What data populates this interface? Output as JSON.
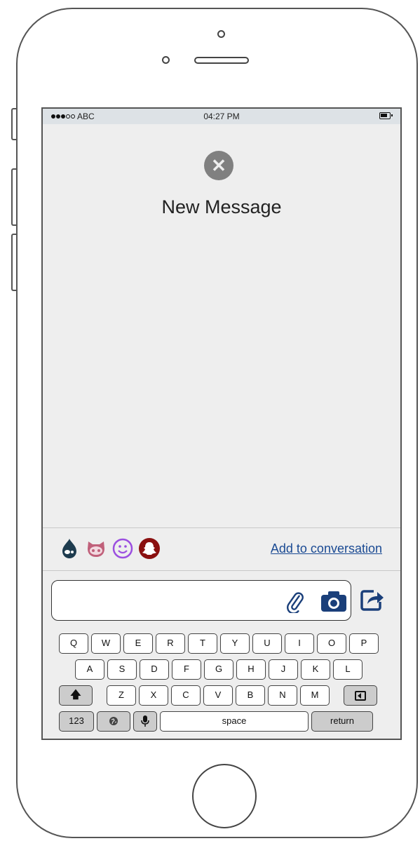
{
  "status_bar": {
    "carrier": "ABC",
    "time": "04:27 PM"
  },
  "screen": {
    "title": "New Message",
    "close_icon": "close-circle-icon"
  },
  "apps": {
    "icons": [
      "drupal-icon",
      "github-octocat-icon",
      "smiley-face-icon",
      "snapchat-ghost-icon"
    ],
    "colors": [
      "#1d3b4e",
      "#c0607a",
      "#9b4fe0",
      "#8a1010"
    ],
    "add_link": "Add to conversation"
  },
  "composer": {
    "placeholder": "",
    "attach_icon": "paperclip-icon",
    "camera_icon": "camera-icon",
    "share_icon": "share-arrow-icon",
    "accent": "#1a3f7a"
  },
  "keyboard": {
    "row1": [
      "Q",
      "W",
      "E",
      "R",
      "T",
      "Y",
      "U",
      "I",
      "O",
      "P"
    ],
    "row2": [
      "A",
      "S",
      "D",
      "F",
      "G",
      "H",
      "J",
      "K",
      "L"
    ],
    "row3": [
      "Z",
      "X",
      "C",
      "V",
      "B",
      "N",
      "M"
    ],
    "shift_icon": "shift-arrow-icon",
    "backspace_icon": "backspace-icon",
    "numbers_label": "123",
    "globe_icon": "globe-icon",
    "mic_icon": "microphone-icon",
    "space_label": "space",
    "return_label": "return"
  }
}
